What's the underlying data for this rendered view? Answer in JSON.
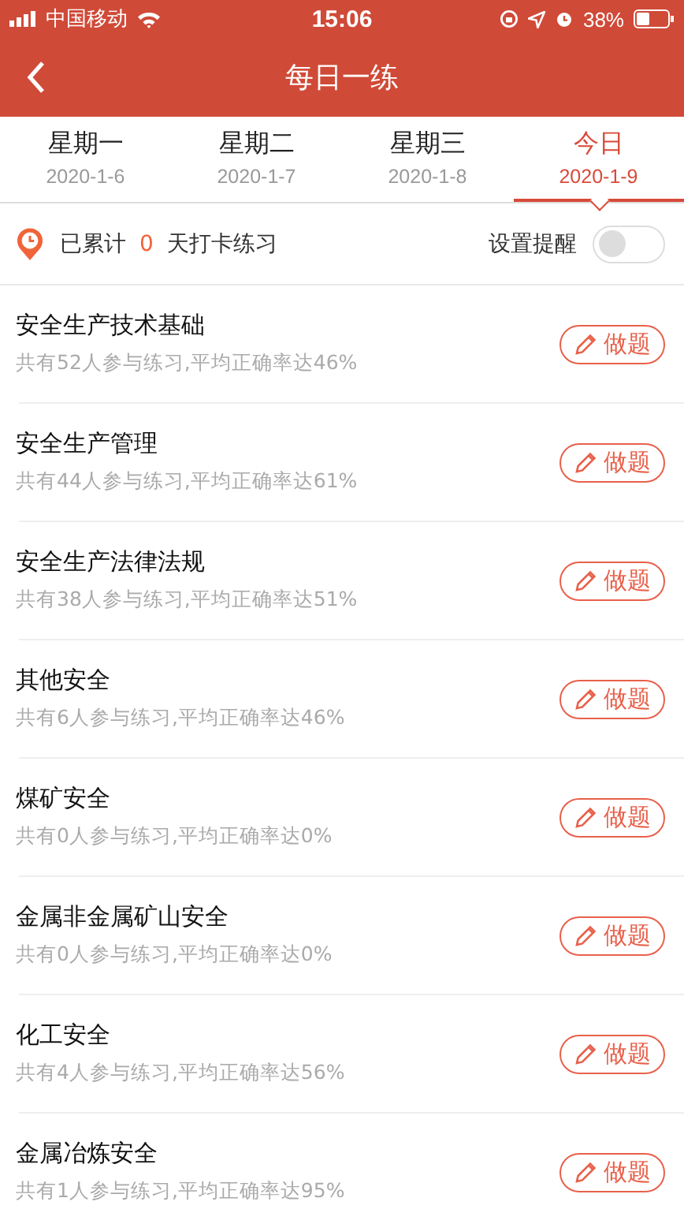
{
  "status_bar": {
    "carrier": "中国移动",
    "time": "15:06",
    "battery": "38%"
  },
  "nav": {
    "title": "每日一练"
  },
  "tabs": [
    {
      "label": "星期一",
      "date": "2020-1-6",
      "selected": false
    },
    {
      "label": "星期二",
      "date": "2020-1-7",
      "selected": false
    },
    {
      "label": "星期三",
      "date": "2020-1-8",
      "selected": false
    },
    {
      "label": "今日",
      "date": "2020-1-9",
      "selected": true
    }
  ],
  "streak": {
    "prefix": "已累计",
    "count": "0",
    "suffix": "天打卡练习",
    "reminder_label": "设置提醒",
    "reminder_on": false
  },
  "items": [
    {
      "title": "安全生产技术基础",
      "subtitle": "共有52人参与练习,平均正确率达46%",
      "button": "做题"
    },
    {
      "title": "安全生产管理",
      "subtitle": "共有44人参与练习,平均正确率达61%",
      "button": "做题"
    },
    {
      "title": "安全生产法律法规",
      "subtitle": "共有38人参与练习,平均正确率达51%",
      "button": "做题"
    },
    {
      "title": "其他安全",
      "subtitle": "共有6人参与练习,平均正确率达46%",
      "button": "做题"
    },
    {
      "title": "煤矿安全",
      "subtitle": "共有0人参与练习,平均正确率达0%",
      "button": "做题"
    },
    {
      "title": "金属非金属矿山安全",
      "subtitle": "共有0人参与练习,平均正确率达0%",
      "button": "做题"
    },
    {
      "title": "化工安全",
      "subtitle": "共有4人参与练习,平均正确率达56%",
      "button": "做题"
    },
    {
      "title": "金属冶炼安全",
      "subtitle": "共有1人参与练习,平均正确率达95%",
      "button": "做题"
    }
  ]
}
